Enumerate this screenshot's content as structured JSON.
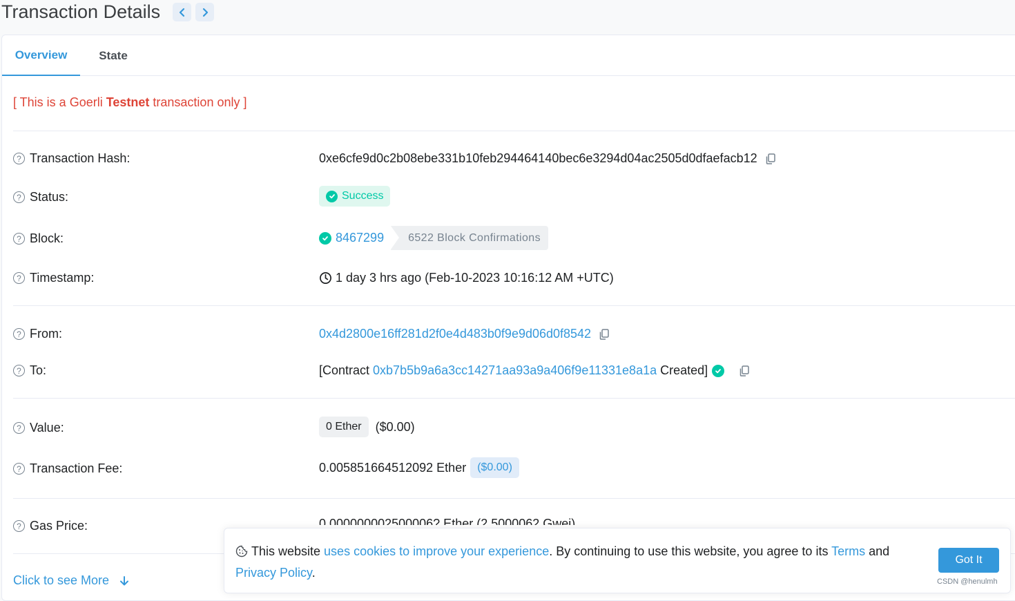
{
  "header": {
    "title": "Transaction Details"
  },
  "tabs": [
    {
      "label": "Overview"
    },
    {
      "label": "State"
    }
  ],
  "notice": {
    "prefix": "[ This is a Goerli ",
    "bold": "Testnet",
    "suffix": " transaction only ]"
  },
  "rows": {
    "hash": {
      "label": "Transaction Hash:",
      "value": "0xe6cfe9d0c2b08ebe331b10feb294464140bec6e3294d04ac2505d0dfaefacb12"
    },
    "status": {
      "label": "Status:",
      "value": "Success"
    },
    "block": {
      "label": "Block:",
      "value": "8467299",
      "confirmations": "6522 Block Confirmations"
    },
    "timestamp": {
      "label": "Timestamp:",
      "value": "1 day 3 hrs ago (Feb-10-2023 10:16:12 AM +UTC)"
    },
    "from": {
      "label": "From:",
      "value": "0x4d2800e16ff281d2f0e4d483b0f9e9d06d0f8542"
    },
    "to": {
      "label": "To:",
      "prefix": "[Contract ",
      "address": "0xb7b5b9a6a3cc14271aa93a9a406f9e11331e8a1a",
      "suffix": " Created]"
    },
    "value": {
      "label": "Value:",
      "amount": "0 Ether",
      "usd": "($0.00)"
    },
    "fee": {
      "label": "Transaction Fee:",
      "amount": "0.005851664512092 Ether",
      "usd": "($0.00)"
    },
    "gas": {
      "label": "Gas Price:",
      "value": "0.000000002500006? Ether (2.5000062 Gwei)"
    }
  },
  "see_more": {
    "label": "Click to see More"
  },
  "cookie": {
    "text1": "This website ",
    "link1": "uses cookies to improve your experience",
    "text2": ". By continuing to use this website, you agree to its ",
    "link2": "Terms",
    "text3": " and ",
    "link3": "Privacy Policy",
    "text4": ".",
    "button": "Got It"
  },
  "watermark": "CSDN @henulmh",
  "colors": {
    "accent": "#3498db",
    "success": "#00c9a7",
    "danger": "#de4437"
  }
}
